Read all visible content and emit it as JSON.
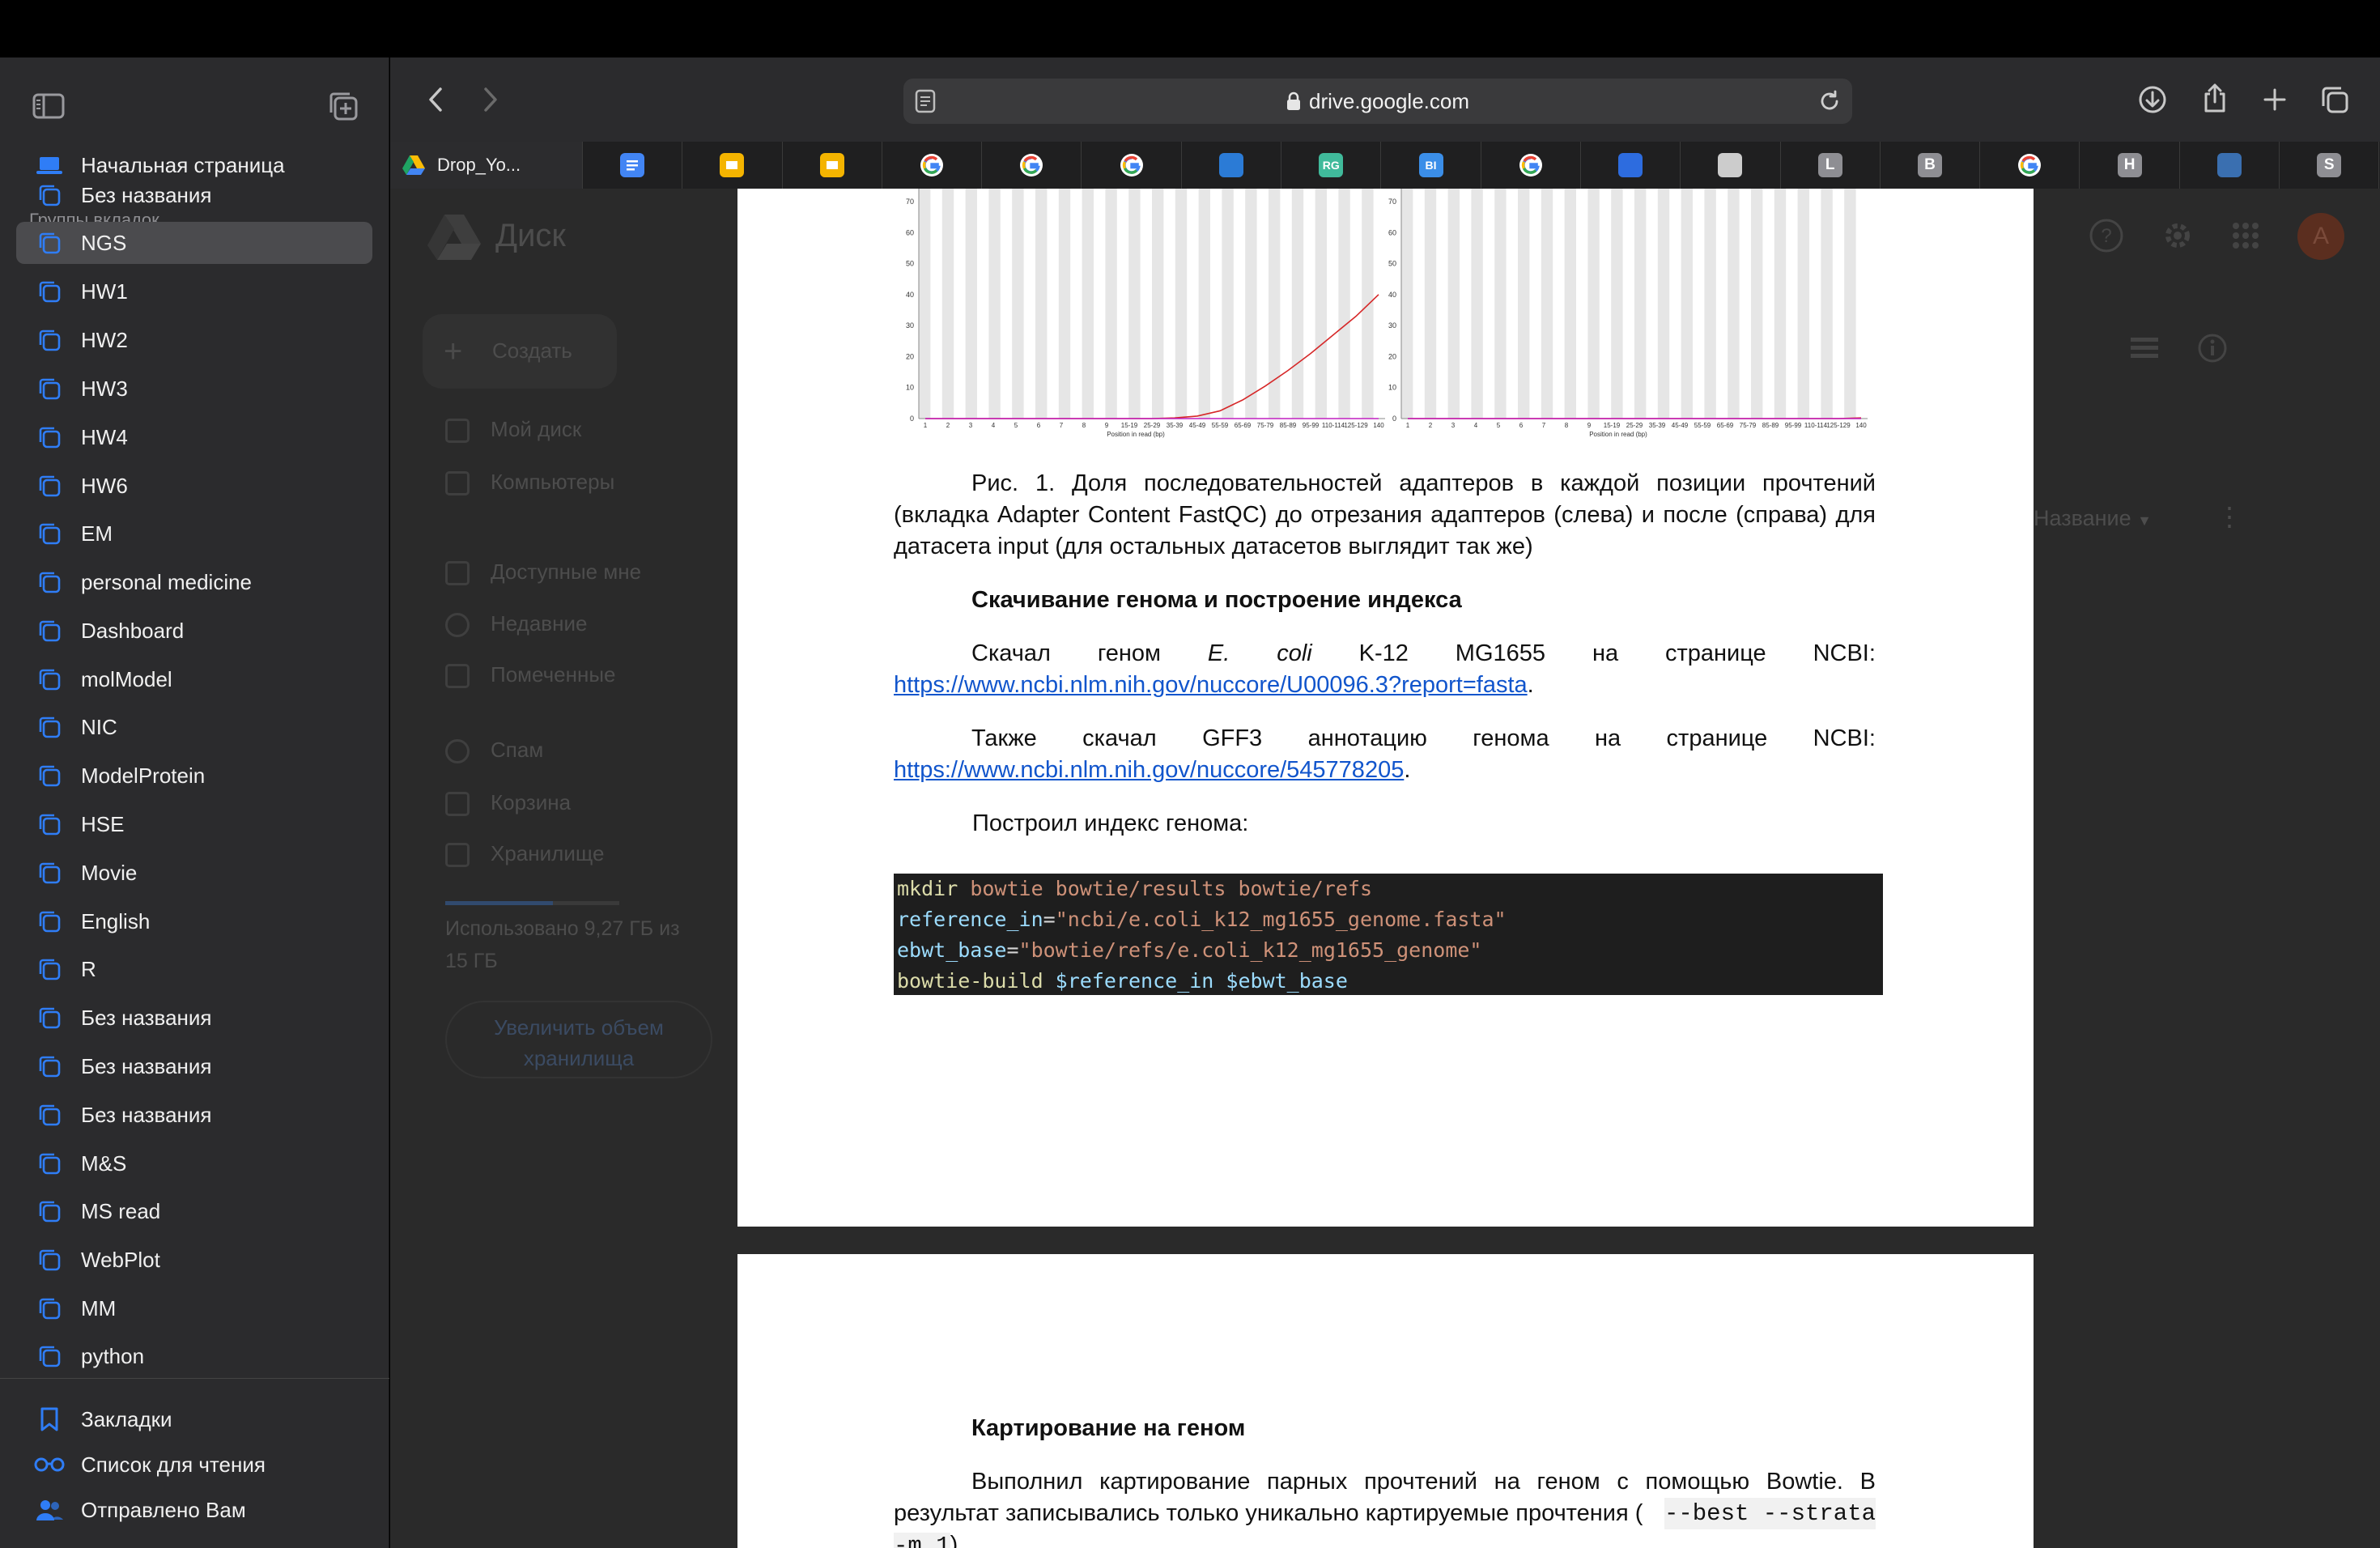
{
  "browser": {
    "url": "drive.google.com",
    "tabs": [
      {
        "title": "Drop_Yo...",
        "icon": "google-drive-icon",
        "color": "#1fa463"
      },
      {
        "title": "",
        "icon": "google-docs-icon",
        "color": "#4285f4"
      },
      {
        "title": "",
        "icon": "google-slides-icon",
        "color": "#f4b400"
      },
      {
        "title": "",
        "icon": "google-slides-icon",
        "color": "#f4b400"
      },
      {
        "title": "",
        "icon": "google-icon",
        "color": "#ffffff"
      },
      {
        "title": "",
        "icon": "google-icon",
        "color": "#ffffff"
      },
      {
        "title": "",
        "icon": "google-icon",
        "color": "#ffffff"
      },
      {
        "title": "",
        "icon": "music-icon",
        "color": "#2b7bd6"
      },
      {
        "title": "",
        "icon": "rg-icon",
        "color": "#40ba9b",
        "letter": "RG"
      },
      {
        "title": "",
        "icon": "bi-icon",
        "color": "#3b8ee8",
        "letter": "BI"
      },
      {
        "title": "",
        "icon": "google-icon",
        "color": "#ffffff"
      },
      {
        "title": "",
        "icon": "chart-app-icon",
        "color": "#2d6cdf"
      },
      {
        "title": "",
        "icon": "reader-icon",
        "color": "#cccccc"
      },
      {
        "title": "",
        "icon": "letter-l-icon",
        "color": "#8e8e93",
        "letter": "L"
      },
      {
        "title": "",
        "icon": "letter-b-icon",
        "color": "#8e8e93",
        "letter": "B"
      },
      {
        "title": "",
        "icon": "google-icon",
        "color": "#ffffff"
      },
      {
        "title": "",
        "icon": "letter-h-icon",
        "color": "#8e8e93",
        "letter": "H"
      },
      {
        "title": "",
        "icon": "r-project-icon",
        "color": "#3a6fb0"
      },
      {
        "title": "",
        "icon": "letter-s-icon",
        "color": "#8e8e93",
        "letter": "S"
      }
    ]
  },
  "sidebar": {
    "start_page": "Начальная страница",
    "groups_header": "Группы вкладок",
    "groups": [
      "Без названия",
      "NGS",
      "HW1",
      "HW2",
      "HW3",
      "HW4",
      "HW6",
      "EM",
      "personal medicine",
      "Dashboard",
      "molModel",
      "NIC",
      "ModelProtein",
      "HSE",
      "Movie",
      "English",
      "R",
      "Без названия",
      "Без названия",
      "Без названия",
      "M&S",
      "MS read",
      "WebPlot",
      "MM",
      "python"
    ],
    "active_group_index": 1,
    "bottom": {
      "bookmarks": "Закладки",
      "reading_list": "Список для чтения",
      "shared": "Отправлено Вам"
    }
  },
  "drive": {
    "title": "Диск",
    "create": "Создать",
    "nav": [
      "Мой диск",
      "Компьютеры",
      "Доступные мне",
      "Недавние",
      "Помеченные",
      "Спам",
      "Корзина",
      "Хранилище"
    ],
    "storage_used": "Использовано 9,27 ГБ из 15 ГБ",
    "storage_used_line1": "Использовано 9,27 ГБ из",
    "storage_used_line2": "15 ГБ",
    "upgrade_line1": "Увеличить объем",
    "upgrade_line2": "хранилища",
    "sort_label": "Название",
    "avatar_letter": "A",
    "storage_fraction": 0.62
  },
  "document": {
    "figure_caption": "Рис. 1. Доля последовательностей адаптеров в каждой позиции прочтений (вкладка Adapter Content FastQC) до отрезания адаптеров (слева) и после (справа) для датасета input (для остальных датасетов выглядит так же)",
    "caption_line1": "Рис. 1. Доля последовательностей адаптеров в каждой позиции прочтений",
    "caption_line2": "(вкладка Adapter Content FastQC) до отрезания адаптеров (слева) и после (справа) для",
    "caption_line3": "датасета input (для остальных датасетов выглядит так же)",
    "section1_heading": "Скачивание генома и построение индекса",
    "p1_line1": "Скачал геном E. coli K-12 MG1655 на странице NCBI:",
    "p1_words": [
      "Скачал",
      "геном",
      "E.",
      "coli",
      "K-12",
      "MG1655",
      "на",
      "странице",
      "NCBI:"
    ],
    "p1_link": "https://www.ncbi.nlm.nih.gov/nuccore/U00096.3?report=fasta",
    "p2_words": [
      "Также",
      "скачал",
      "GFF3",
      "аннотацию",
      "генома",
      "на",
      "странице",
      "NCBI:"
    ],
    "p2_link": "https://www.ncbi.nlm.nih.gov/nuccore/545778205",
    "p3": "Построил индекс генома:",
    "code": {
      "l1_cmd": "mkdir",
      "l1_args": " bowtie bowtie/results bowtie/refs",
      "l2_var": "reference_in",
      "l2_eq": "=",
      "l2_str": "\"ncbi/e.coli_k12_mg1655_genome.fasta\"",
      "l3_var": "ebwt_base",
      "l3_eq": "=",
      "l3_str": "\"bowtie/refs/e.coli_k12_mg1655_genome\"",
      "l4_cmd": "bowtie-build",
      "l4_a1": " $reference_in",
      "l4_a2": " $ebwt_base"
    },
    "section2_heading": "Картирование на геном",
    "p4_line1": "Выполнил картирование парных прочтений на геном с помощью Bowtie. В",
    "p4_line2_pre": "результат записывались только уникально картируемые прочтения (",
    "p4_line2_code": "--best --strata",
    "p4_line3_code": "-m 1",
    "p4_line3_post": ")."
  },
  "chart_data": [
    {
      "type": "line",
      "title": "",
      "xlabel": "Position in read (bp)",
      "ylabel": "",
      "ylim": [
        0,
        70
      ],
      "y_ticks": [
        0,
        10,
        20,
        30,
        40,
        50,
        60,
        70
      ],
      "x_ticks": [
        "1",
        "2",
        "3",
        "4",
        "5",
        "6",
        "7",
        "8",
        "9",
        "15-19",
        "25-29",
        "35-39",
        "45-49",
        "55-59",
        "65-69",
        "75-79",
        "85-89",
        "95-99",
        "110-114",
        "125-129",
        "140"
      ],
      "series": [
        {
          "values": [
            0,
            0,
            0,
            0,
            0,
            0,
            0,
            0,
            0,
            0,
            0,
            0.2,
            0.8,
            2.5,
            6,
            10.5,
            15.5,
            21,
            27,
            33,
            40
          ]
        },
        {
          "values": [
            0,
            0,
            0,
            0,
            0,
            0,
            0,
            0,
            0,
            0,
            0,
            0,
            0,
            0,
            0,
            0,
            0,
            0,
            0,
            0,
            0
          ]
        }
      ]
    },
    {
      "type": "line",
      "title": "",
      "xlabel": "Position in read (bp)",
      "ylabel": "",
      "ylim": [
        0,
        70
      ],
      "y_ticks": [
        0,
        10,
        20,
        30,
        40,
        50,
        60,
        70
      ],
      "x_ticks": [
        "1",
        "2",
        "3",
        "4",
        "5",
        "6",
        "7",
        "8",
        "9",
        "15-19",
        "25-29",
        "35-39",
        "45-49",
        "55-59",
        "65-69",
        "75-79",
        "85-89",
        "95-99",
        "110-114",
        "125-129",
        "140"
      ],
      "series": [
        {
          "values": [
            0,
            0,
            0,
            0,
            0,
            0,
            0,
            0,
            0,
            0,
            0,
            0,
            0,
            0,
            0,
            0,
            0,
            0,
            0,
            0,
            0.2
          ]
        },
        {
          "values": [
            0,
            0,
            0,
            0,
            0,
            0,
            0,
            0,
            0,
            0,
            0,
            0,
            0,
            0,
            0,
            0,
            0,
            0,
            0,
            0,
            0
          ]
        }
      ]
    }
  ]
}
